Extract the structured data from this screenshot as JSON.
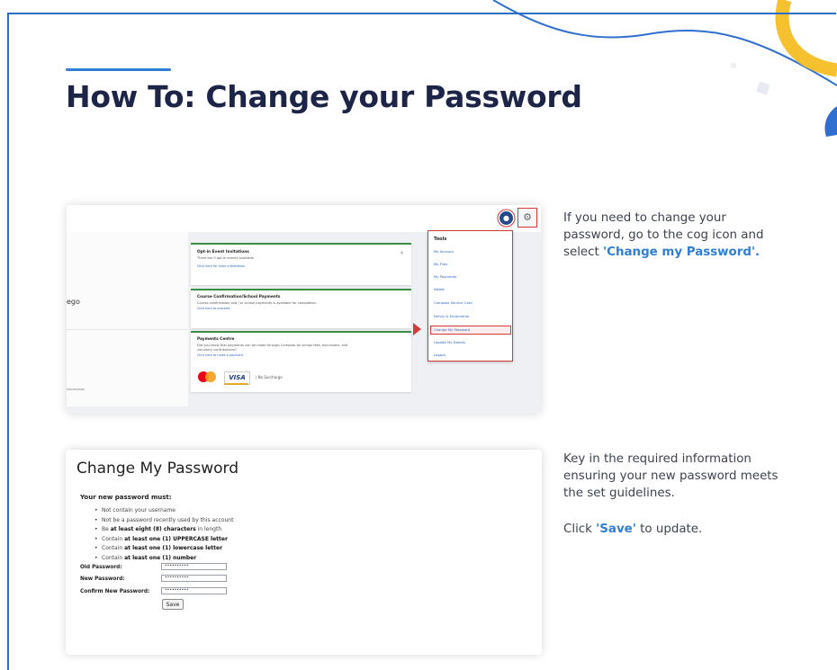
{
  "page": {
    "title": "How To: Change your Password",
    "colors": {
      "accent": "#2f7fd6",
      "title": "#1c2547",
      "deco_yellow": "#f5c12e",
      "alert_red": "#d33b3b"
    }
  },
  "step1": {
    "text_lines": [
      "If you need to change your",
      "password, go to the cog icon and",
      "select "
    ],
    "text_highlight": "'Change my Password'",
    "text_end": ".",
    "screenshot": {
      "profile_icon": "user-circle-icon",
      "cog_icon": "gear-icon",
      "partial_label": "ego",
      "partial_small_text": "information",
      "cards": [
        {
          "title": "Opt-in Event Invitations",
          "text": "There are 0 opt-in events available",
          "link": "Click here for more information"
        },
        {
          "title": "Course Confirmation/School Payments",
          "text": "Course confirmation and / or school payments is available for completion.",
          "link": "Click here to proceed"
        },
        {
          "title": "Payments Centre",
          "text": "Did you know that payments can be made through Compass for school fees, excursions, and",
          "text2": "voluntary contributions?",
          "link": "Click here to make a payment",
          "payment_note": "| No Surcharge"
        }
      ],
      "payment_icons": [
        "mastercard-icon",
        "visa-icon"
      ],
      "visa_label": "VISA",
      "tools_menu": {
        "heading": "Tools",
        "items": [
          "My Account",
          "My Files",
          "My Payments",
          "Wallet",
          "Compass Service Card",
          "Family & Enrolments",
          "Change My Password",
          "Update My Details",
          "Logout"
        ],
        "highlighted_index": 6
      }
    }
  },
  "step2": {
    "text_lines": [
      "Key in the required information",
      "ensuring your new password meets",
      "the set guidelines."
    ],
    "click_pre": "Click ",
    "click_highlight": "'Save'",
    "click_post": " to update.",
    "screenshot": {
      "title": "Change My Password",
      "must_label": "Your new password must:",
      "rules": [
        {
          "pre": "Not contain your username",
          "bold": "",
          "post": ""
        },
        {
          "pre": "Not be a password recently used by this account",
          "bold": "",
          "post": ""
        },
        {
          "pre": "Be ",
          "bold": "at least eight (8) characters",
          "post": " in length"
        },
        {
          "pre": "Contain ",
          "bold": "at least one (1) UPPERCASE letter",
          "post": ""
        },
        {
          "pre": "Contain ",
          "bold": "at least one (1) lowercase letter",
          "post": ""
        },
        {
          "pre": "Contain ",
          "bold": "at least one (1) number",
          "post": ""
        }
      ],
      "fields": [
        {
          "label": "Old Password:",
          "value": "••••••••••"
        },
        {
          "label": "New Password:",
          "value": "••••••••••"
        },
        {
          "label": "Confirm New Password:",
          "value": "••••••••••"
        }
      ],
      "save_label": "Save"
    }
  }
}
